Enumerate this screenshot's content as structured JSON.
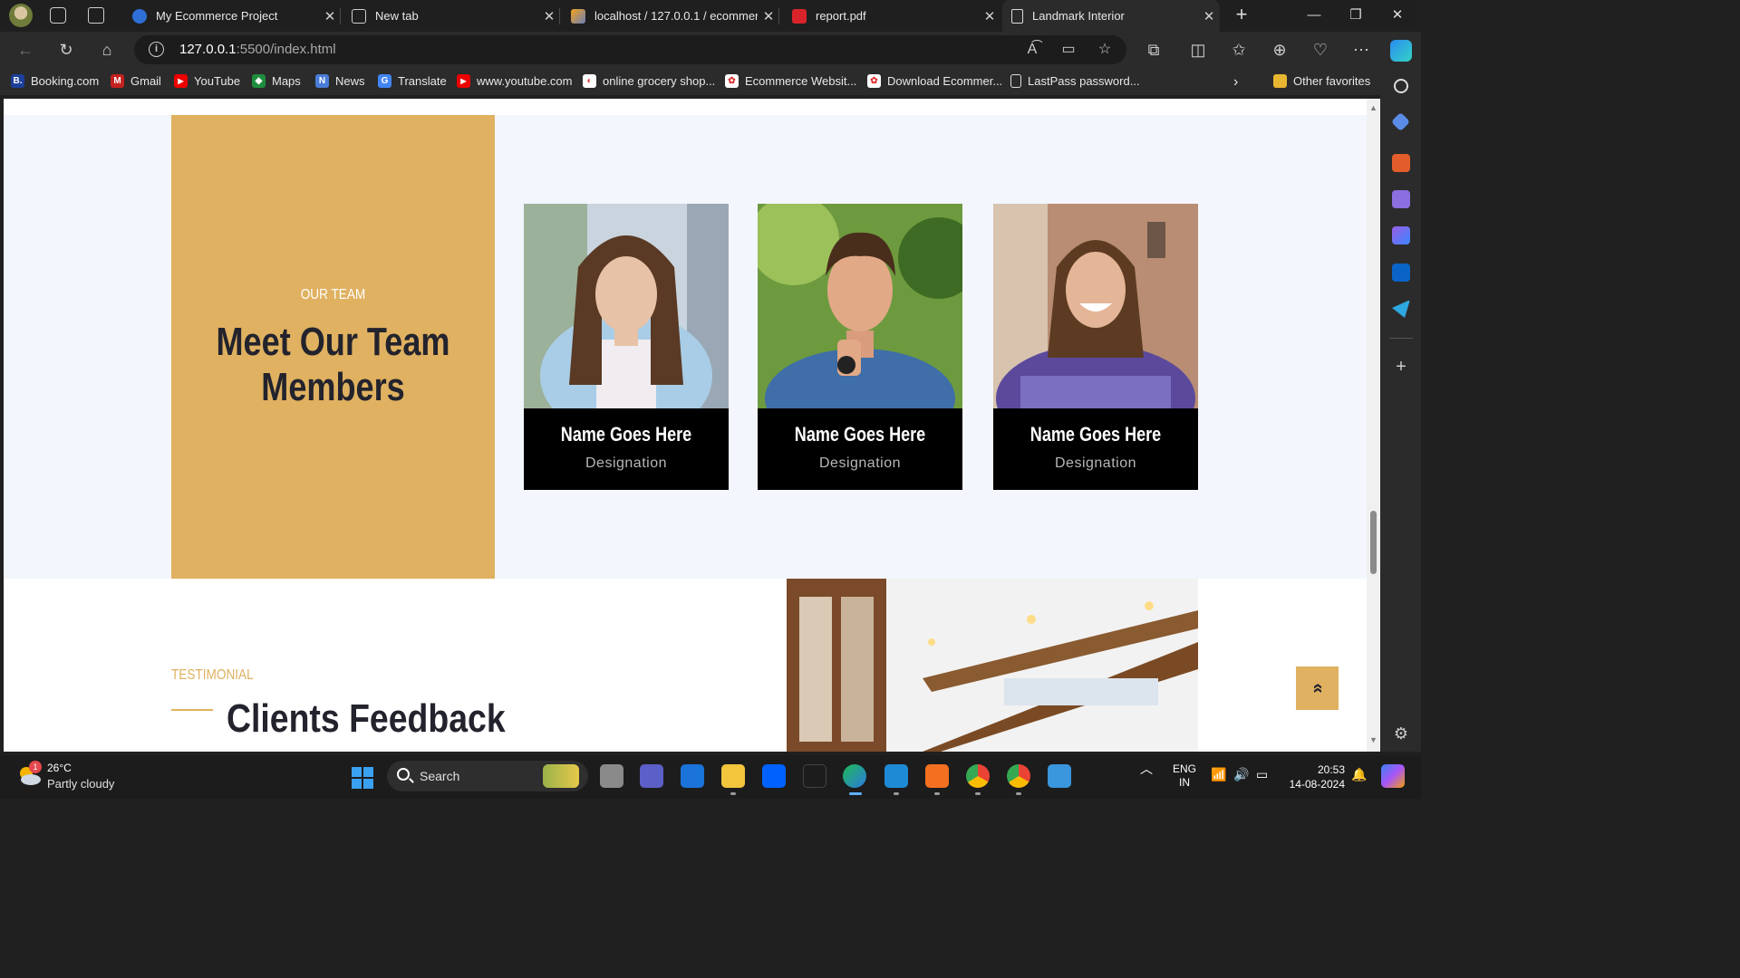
{
  "browser": {
    "tabs": [
      {
        "title": "My Ecommerce Project",
        "active": false
      },
      {
        "title": "New tab",
        "active": false
      },
      {
        "title": "localhost / 127.0.0.1 / ecommerc",
        "active": false
      },
      {
        "title": "report.pdf",
        "active": false
      },
      {
        "title": "Landmark Interior",
        "active": true
      }
    ],
    "address": {
      "host": "127.0.0.1",
      "path": ":5500/index.html"
    },
    "bookmarks": [
      {
        "label": "Booking.com",
        "icon": "booking-icon",
        "letter": "B."
      },
      {
        "label": "Gmail",
        "icon": "gmail-icon",
        "letter": "M"
      },
      {
        "label": "YouTube",
        "icon": "youtube-icon",
        "letter": "▶"
      },
      {
        "label": "Maps",
        "icon": "maps-icon",
        "letter": "◆"
      },
      {
        "label": "News",
        "icon": "news-icon",
        "letter": "N"
      },
      {
        "label": "Translate",
        "icon": "translate-icon",
        "letter": "G"
      },
      {
        "label": "www.youtube.com",
        "icon": "youtube-icon",
        "letter": "▶"
      },
      {
        "label": "online grocery shop...",
        "icon": "grocery-icon",
        "letter": "◐"
      },
      {
        "label": "Ecommerce Websit...",
        "icon": "ecommerce-icon",
        "letter": "✿"
      },
      {
        "label": "Download Ecommer...",
        "icon": "ecommerce-icon",
        "letter": "✿"
      },
      {
        "label": "LastPass password...",
        "icon": "page-icon",
        "letter": ""
      }
    ],
    "other_favorites": "Other favorites"
  },
  "page": {
    "team": {
      "eyebrow": "OUR TEAM",
      "title": "Meet Our Team Members",
      "members": [
        {
          "name": "Name Goes Here",
          "designation": "Designation"
        },
        {
          "name": "Name Goes Here",
          "designation": "Designation"
        },
        {
          "name": "Name Goes Here",
          "designation": "Designation"
        }
      ]
    },
    "testimonial": {
      "eyebrow": "TESTIMONIAL",
      "title": "Clients Feedback"
    },
    "back_to_top": "»",
    "colors": {
      "accent": "#dfb160",
      "section_bg": "#f3f6fd",
      "heading": "#23232d"
    }
  },
  "taskbar": {
    "weather": {
      "temp": "26°C",
      "condition": "Partly cloudy",
      "badge": "1"
    },
    "search_label": "Search",
    "language": {
      "line1": "ENG",
      "line2": "IN"
    },
    "time": "20:53",
    "date": "14-08-2024"
  }
}
